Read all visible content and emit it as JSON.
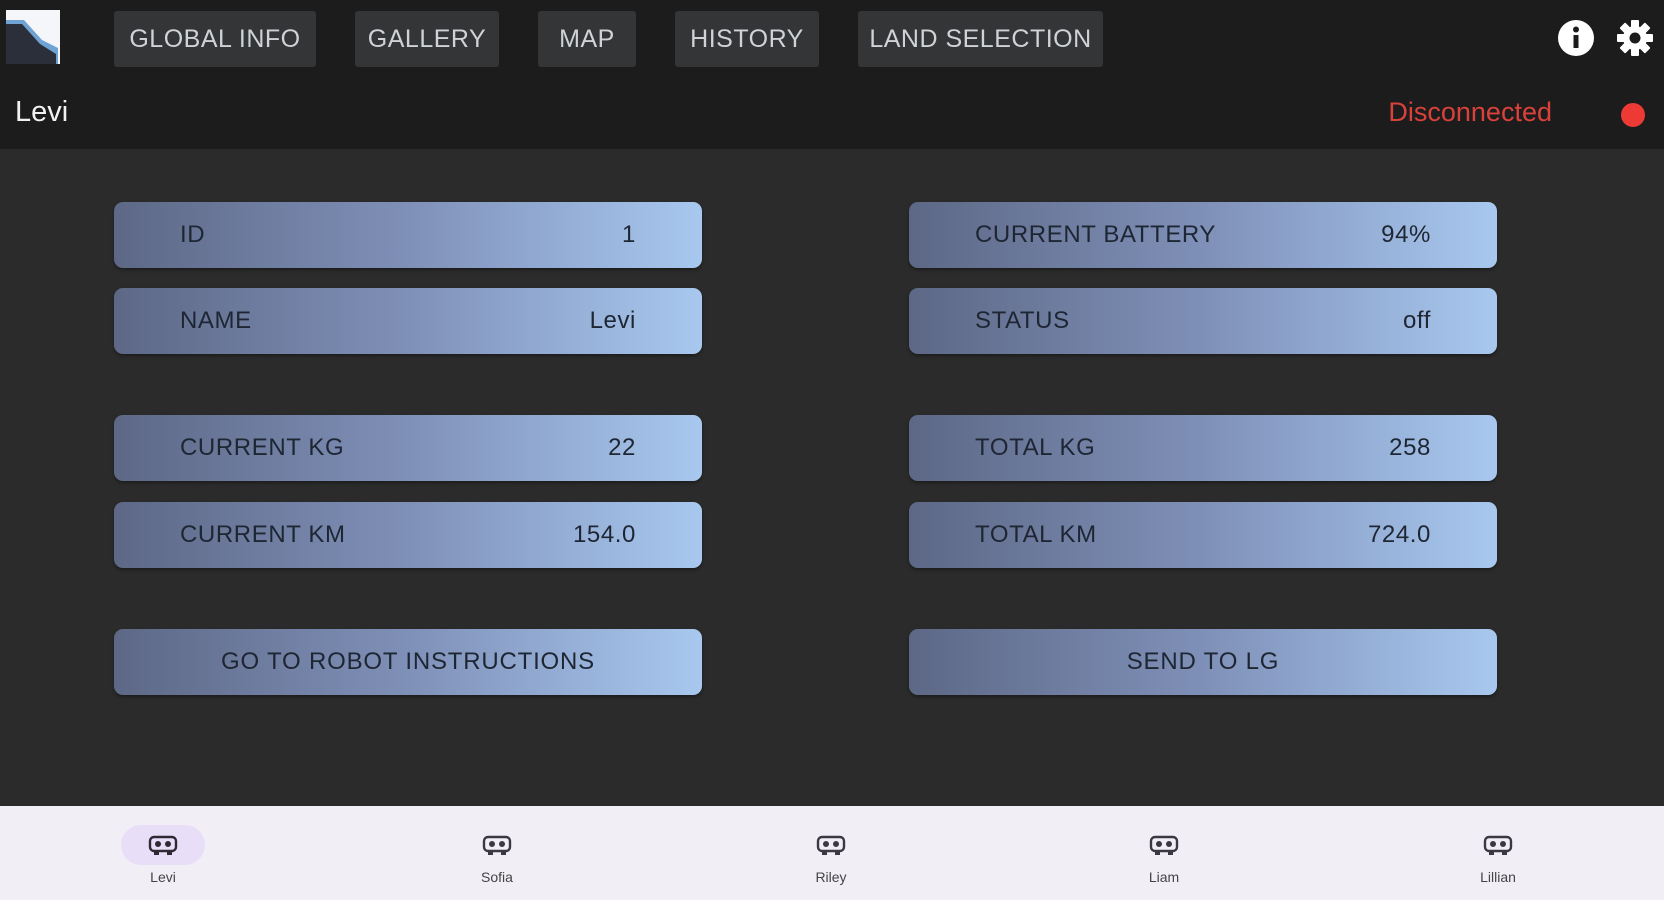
{
  "header": {
    "nav": [
      {
        "label": "GLOBAL INFO"
      },
      {
        "label": "GALLERY"
      },
      {
        "label": "MAP"
      },
      {
        "label": "HISTORY"
      },
      {
        "label": "LAND SELECTION"
      }
    ],
    "robot_name": "Levi",
    "connection_status": "Disconnected",
    "icons": {
      "info": "info-icon",
      "settings": "gear-icon",
      "logo": "app-logo"
    }
  },
  "fields": {
    "id": {
      "label": "ID",
      "value": "1"
    },
    "name": {
      "label": "NAME",
      "value": "Levi"
    },
    "current_battery": {
      "label": "CURRENT BATTERY",
      "value": "94%"
    },
    "status": {
      "label": "STATUS",
      "value": "off"
    },
    "current_kg": {
      "label": "CURRENT KG",
      "value": "22"
    },
    "total_kg": {
      "label": "TOTAL KG",
      "value": "258"
    },
    "current_km": {
      "label": "CURRENT KM",
      "value": "154.0"
    },
    "total_km": {
      "label": "TOTAL KM",
      "value": "724.0"
    }
  },
  "actions": {
    "robot_instructions": "GO TO ROBOT INSTRUCTIONS",
    "send_to_lg": "SEND TO LG"
  },
  "bottom_nav": {
    "active": "Levi",
    "tabs": [
      {
        "label": "Levi",
        "icon": "robot-icon"
      },
      {
        "label": "Sofia",
        "icon": "robot-icon"
      },
      {
        "label": "Riley",
        "icon": "robot-icon"
      },
      {
        "label": "Liam",
        "icon": "robot-icon"
      },
      {
        "label": "Lillian",
        "icon": "robot-icon"
      }
    ]
  },
  "colors": {
    "topbar": "#1c1c1c",
    "background": "#2b2b2b",
    "disconnected": "#d9413b",
    "field_gradient_start": "#5d6886",
    "field_gradient_end": "#a8c8ef",
    "bottom_nav": "#f2eef6",
    "active_tab_pill": "#e8def8"
  }
}
